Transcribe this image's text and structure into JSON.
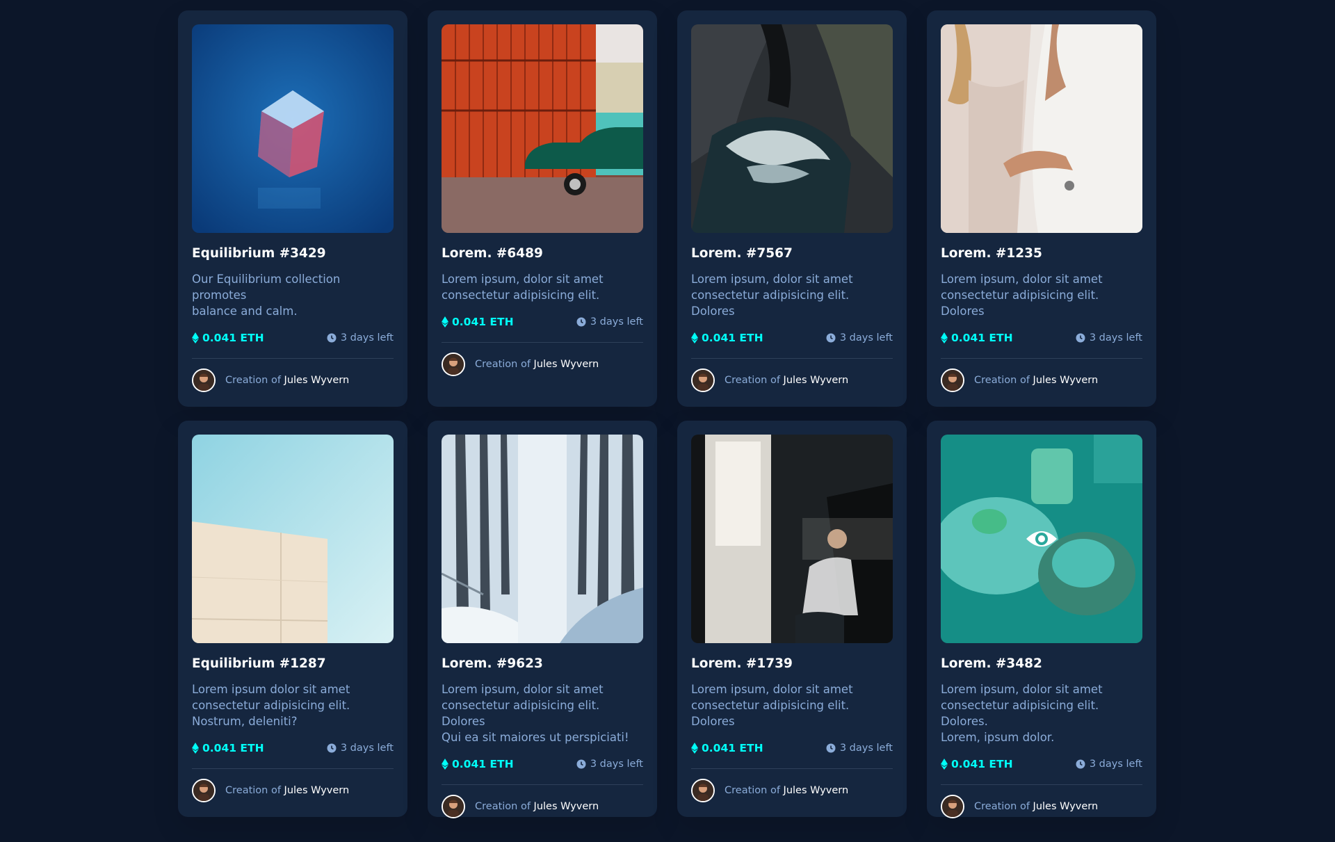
{
  "cards": [
    {
      "title": "Equilibrium #3429",
      "description": "Our Equilibrium collection promotes\nbalance and calm.",
      "price": "0.041 ETH",
      "time_left": "3 days left",
      "creator_label": "Creation of",
      "creator_name": "Jules Wyvern",
      "image_icon": "crystal-cube-image"
    },
    {
      "title": "Lorem. #6489",
      "description": "Lorem ipsum, dolor sit amet\nconsectetur adipisicing elit.",
      "price": "0.041 ETH",
      "time_left": "3 days left",
      "creator_label": "Creation of",
      "creator_name": "Jules Wyvern",
      "image_icon": "containers-car-image"
    },
    {
      "title": "Lorem. #7567",
      "description": "Lorem ipsum, dolor sit amet\nconsectetur adipisicing elit. Dolores",
      "price": "0.041 ETH",
      "time_left": "3 days left",
      "creator_label": "Creation of",
      "creator_name": "Jules Wyvern",
      "image_icon": "sea-cave-image"
    },
    {
      "title": "Lorem. #1235",
      "description": "Lorem ipsum, dolor sit amet\nconsectetur adipisicing elit. Dolores",
      "price": "0.041 ETH",
      "time_left": "3 days left",
      "creator_label": "Creation of",
      "creator_name": "Jules Wyvern",
      "image_icon": "couple-image"
    },
    {
      "title": "Equilibrium #1287",
      "description": "Lorem ipsum dolor sit amet\nconsectetur adipisicing elit.\nNostrum, deleniti?",
      "price": "0.041 ETH",
      "time_left": "3 days left",
      "creator_label": "Creation of",
      "creator_name": "Jules Wyvern",
      "image_icon": "building-sky-image"
    },
    {
      "title": "Lorem. #9623",
      "description": "Lorem ipsum, dolor sit amet\nconsectetur adipisicing elit. Dolores\nQui ea sit maiores ut perspiciati!",
      "price": "0.041 ETH",
      "time_left": "3 days left",
      "creator_label": "Creation of",
      "creator_name": "Jules Wyvern",
      "image_icon": "snowy-forest-image"
    },
    {
      "title": "Lorem. #1739",
      "description": "Lorem ipsum, dolor sit amet\nconsectetur adipisicing elit. Dolores",
      "price": "0.041 ETH",
      "time_left": "3 days left",
      "creator_label": "Creation of",
      "creator_name": "Jules Wyvern",
      "image_icon": "person-window-image"
    },
    {
      "title": "Lorem. #3482",
      "description": "Lorem ipsum, dolor sit amet\nconsectetur adipisicing elit. Dolores.\nLorem, ipsum dolor.",
      "price": "0.041 ETH",
      "time_left": "3 days left",
      "creator_label": "Creation of",
      "creator_name": "Jules Wyvern",
      "image_icon": "food-table-image",
      "hovered": true,
      "overlay_icon": "eye-icon"
    }
  ],
  "colors": {
    "page_background": "#0c1629",
    "card_background": "#15263f",
    "accent_cyan": "#00fff8",
    "soft_blue_text": "#8bacd9",
    "white": "#ffffff",
    "divider": "#2e405a"
  }
}
